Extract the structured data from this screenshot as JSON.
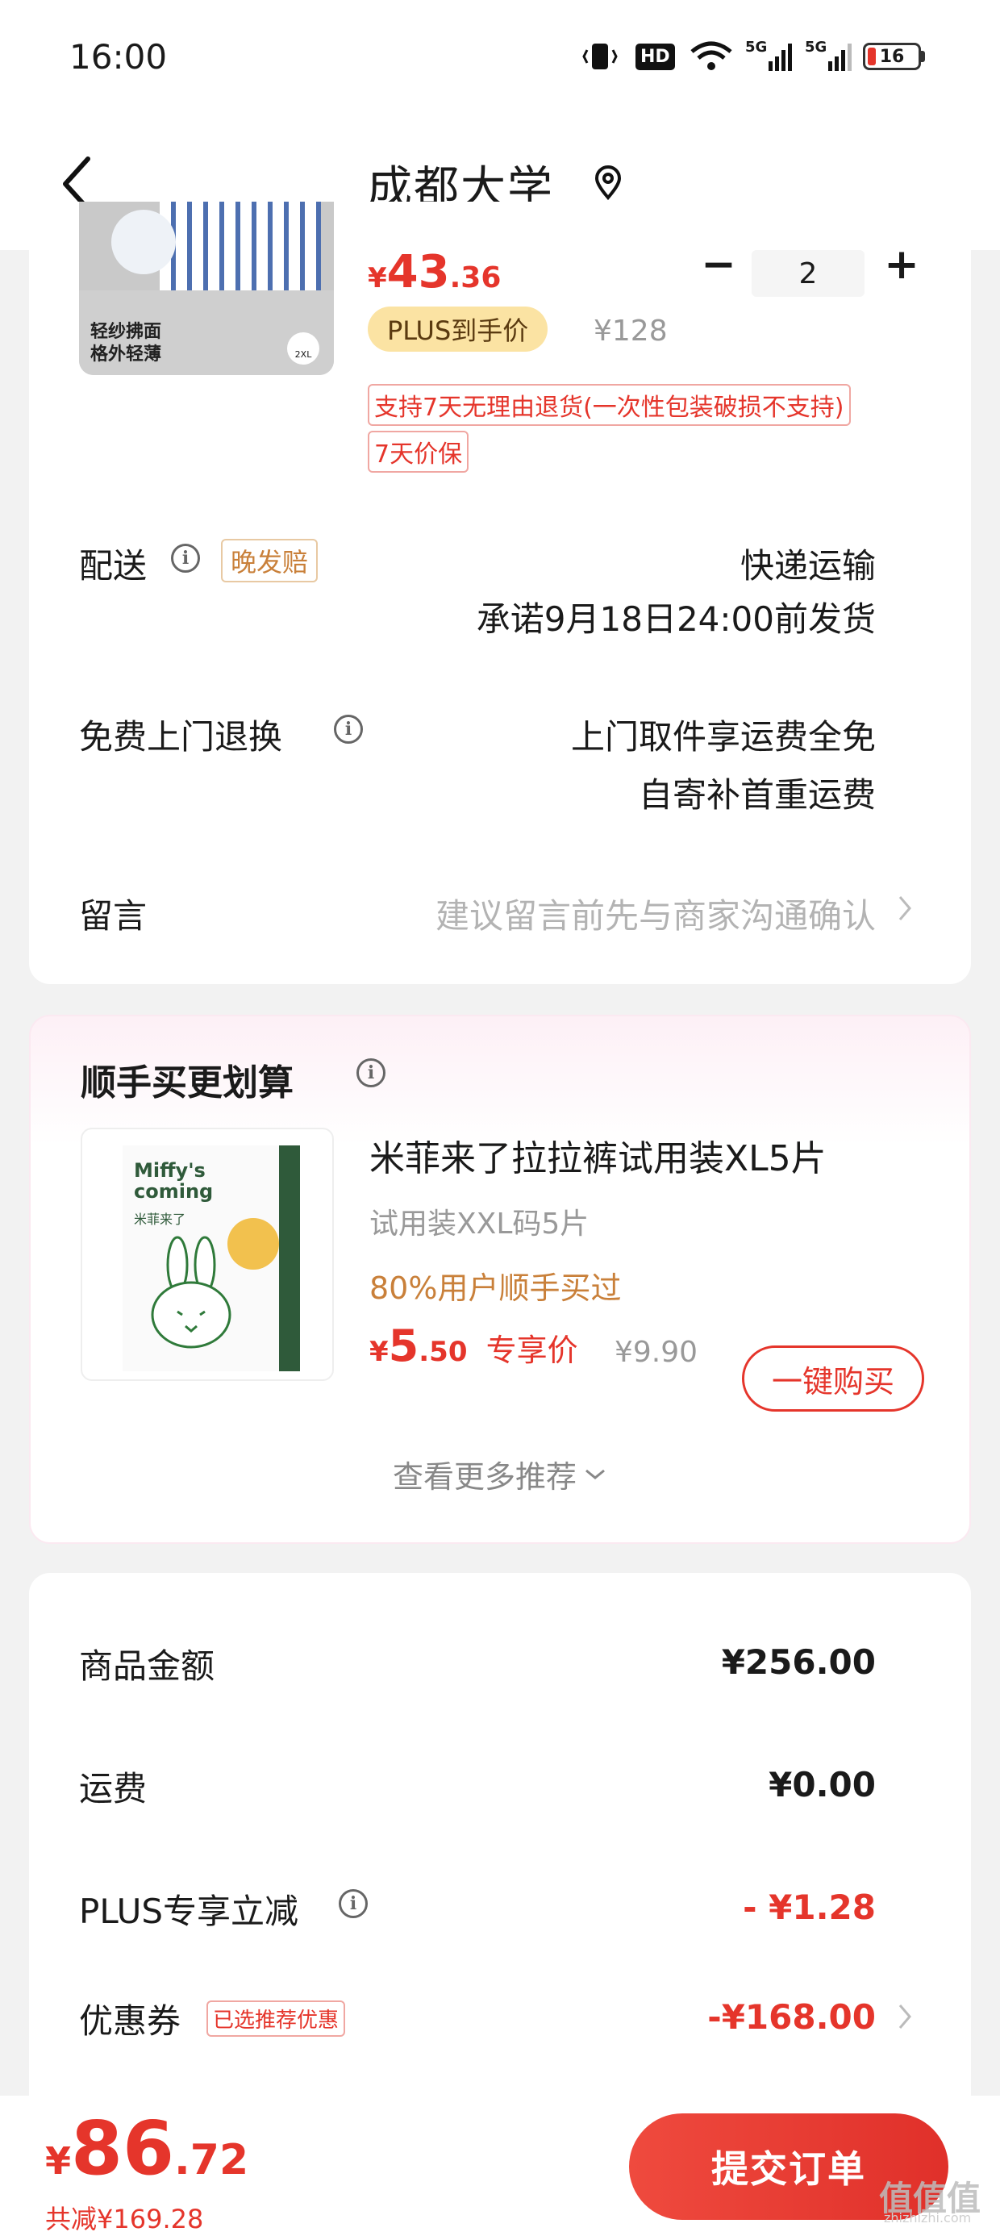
{
  "status_bar": {
    "time": "16:00",
    "hd_badge": "HD",
    "net1": "5G",
    "net2": "5G",
    "battery": "16"
  },
  "header": {
    "title": "成都大学",
    "back_icon": "chevron-left-icon",
    "location_icon": "location-pin-icon"
  },
  "product": {
    "image_text_line1": "轻纱拂面",
    "image_text_line2": "格外轻薄",
    "image_badge": "2XL",
    "price_symbol": "¥",
    "price_int": "43",
    "price_dec": ".36",
    "plus_tag": "PLUS到手价",
    "orig_price": "¥128",
    "qty": "2",
    "minus": "−",
    "plus": "+",
    "tag_return": "支持7天无理由退货(一次性包装破损不支持)",
    "tag_price_protect": "7天价保"
  },
  "delivery": {
    "label": "配送",
    "late_tag": "晚发赔",
    "method": "快递运输",
    "promise": "承诺9月18日24:00前发货"
  },
  "free_return": {
    "label": "免费上门退换",
    "line1": "上门取件享运费全免",
    "line2": "自寄补首重运费"
  },
  "message": {
    "label": "留言",
    "placeholder": "建议留言前先与商家沟通确认"
  },
  "addon": {
    "title": "顺手买更划算",
    "thumb_brand": "Miffy's coming",
    "thumb_cn": "米菲来了",
    "name": "米菲来了拉拉裤试用装XL5片",
    "spec": "试用装XXL码5片",
    "social": "80%用户顺手买过",
    "price_symbol": "¥",
    "price_int": "5",
    "price_dec": ".50",
    "price_label": "专享价",
    "orig_price": "¥9.90",
    "buy_button": "一键购买",
    "more": "查看更多推荐"
  },
  "summary": {
    "goods_label": "商品金额",
    "goods_value": "¥256.00",
    "shipping_label": "运费",
    "shipping_value": "¥0.00",
    "plus_label": "PLUS专享立减",
    "plus_value": "- ¥1.28",
    "coupon_label": "优惠券",
    "coupon_tag": "已选推荐优惠",
    "coupon_value": "-¥168.00"
  },
  "bottom": {
    "total_symbol": "¥",
    "total_int": "86",
    "total_dec": ".72",
    "saved": "共减¥169.28",
    "submit": "提交订单"
  },
  "watermark": {
    "text": "值值值",
    "sub": "zhizhizhi.com"
  },
  "colors": {
    "accent_red": "#e5352b",
    "plus_gold": "#fbe3a3",
    "addon_orange": "#c9803a"
  }
}
